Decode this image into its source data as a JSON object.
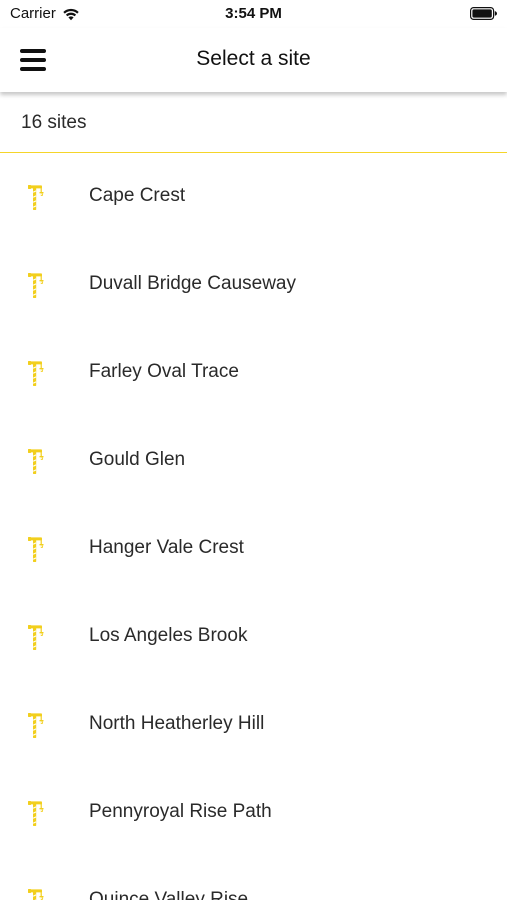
{
  "status_bar": {
    "carrier": "Carrier",
    "time": "3:54 PM"
  },
  "nav": {
    "title": "Select a site",
    "menu_icon": "hamburger-menu-icon"
  },
  "list_header": {
    "count_label": "16 sites"
  },
  "colors": {
    "accent": "#f5d52a",
    "text": "#2a2a2a"
  },
  "site_icon": "crane-icon",
  "sites": [
    {
      "name": "Cape Crest"
    },
    {
      "name": "Duvall Bridge Causeway"
    },
    {
      "name": "Farley Oval Trace"
    },
    {
      "name": "Gould Glen"
    },
    {
      "name": "Hanger Vale Crest"
    },
    {
      "name": "Los Angeles Brook"
    },
    {
      "name": "North Heatherley Hill"
    },
    {
      "name": "Pennyroyal Rise Path"
    },
    {
      "name": "Quince Valley Rise"
    }
  ]
}
